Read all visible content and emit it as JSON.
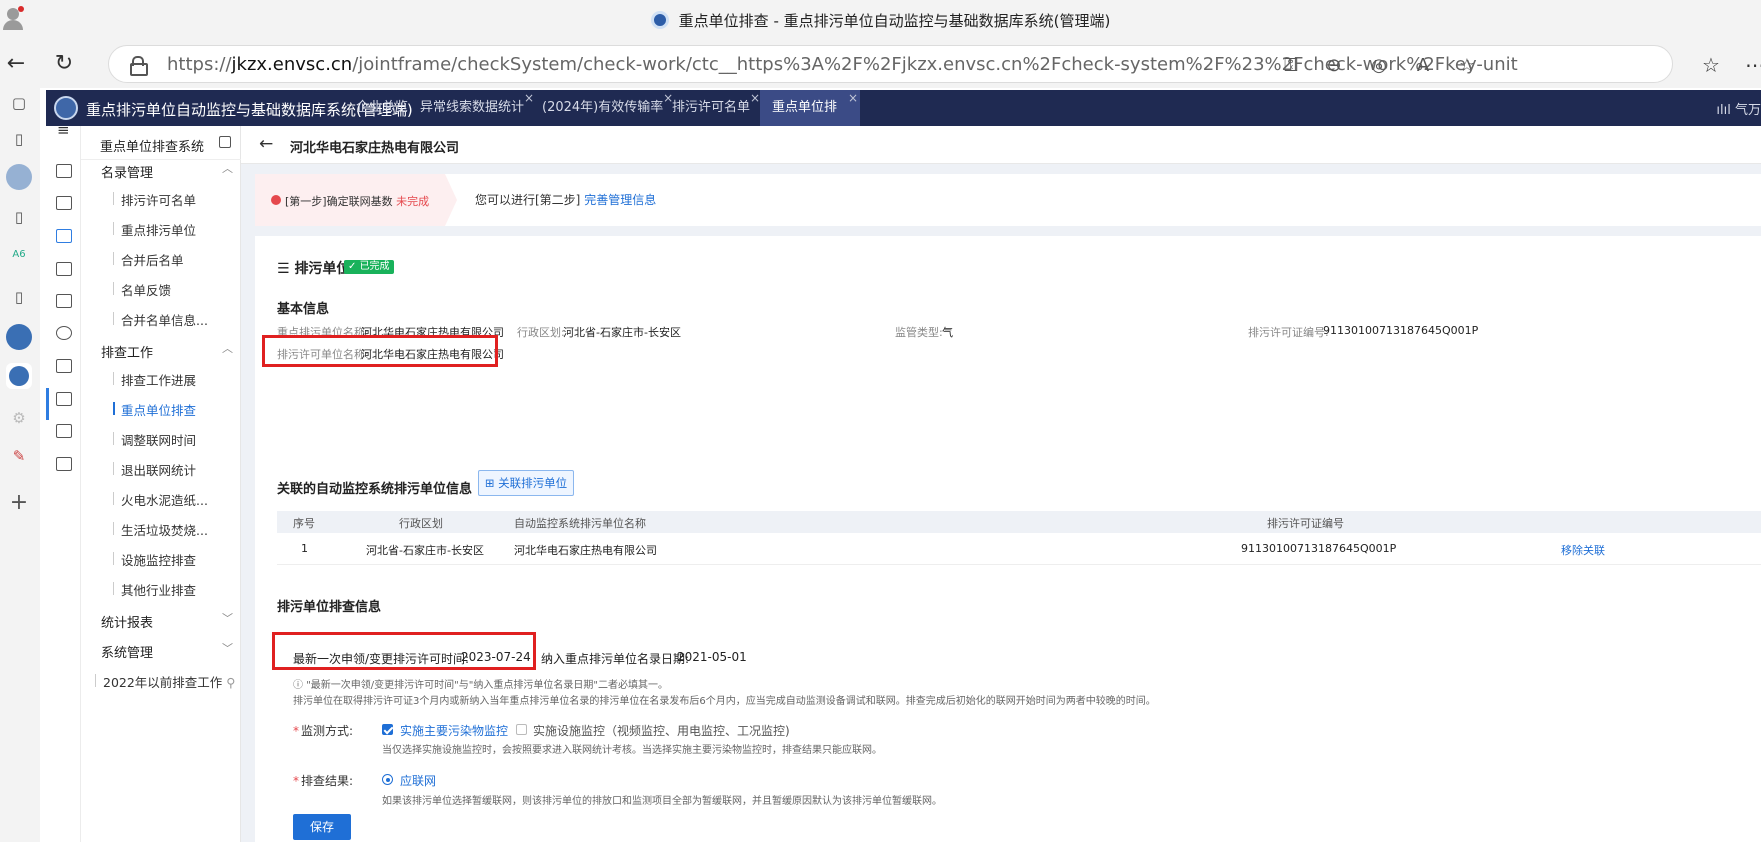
{
  "window": {
    "title": "重点单位排查 - 重点排污单位自动监控与基础数据库系统(管理端)"
  },
  "browser": {
    "url_prefix": "https://",
    "url_host": "jkzx.envsc.cn",
    "url_path": "/jointframe/checkSystem/check-work/ctc__https%3A%2F%2Fjkzx.envsc.cn%2Fcheck-system%2F%23%2Fcheck-work%2Fkey-unit"
  },
  "app": {
    "title": "重点排污单位自动监控与基础数据库系统(管理端)",
    "tabs": [
      {
        "label": "企业总览"
      },
      {
        "label": "异常线索数据统计"
      },
      {
        "label": "(2024年)有效传输率"
      },
      {
        "label": "排污许可名单"
      },
      {
        "label": "重点单位排查"
      }
    ],
    "nav_right": "气万"
  },
  "menu": {
    "title": "重点单位排查系统",
    "groups": [
      {
        "label": "名录管理",
        "items": [
          "排污许可名单",
          "重点排污单位",
          "合并后名单",
          "名单反馈",
          "合并名单信息..."
        ]
      },
      {
        "label": "排查工作",
        "items": [
          "排查工作进展",
          "重点单位排查",
          "调整联网时间",
          "退出联网统计",
          "火电水泥造纸...",
          "生活垃圾焚烧...",
          "设施监控排查",
          "其他行业排查"
        ]
      },
      {
        "label": "统计报表",
        "items": []
      },
      {
        "label": "系统管理",
        "items": []
      }
    ],
    "legacy": "2022年以前排查工作"
  },
  "page": {
    "company": "河北华电石家庄热电有限公司",
    "step1_prefix": "[第一步]确定联网基数",
    "step1_status": "未完成",
    "step2_prefix": "您可以进行[第二步]",
    "step2_link": "完善管理信息"
  },
  "unit": {
    "title": "排污单位",
    "status": "已完成",
    "basic_title": "基本信息",
    "fields": {
      "name_label": "重点排污单位名称:",
      "name_value": "河北华电石家庄热电有限公司",
      "region_label": "行政区划:",
      "region_value": "河北省-石家庄市-长安区",
      "monitor_label": "监管类型:",
      "monitor_value": "气",
      "permit_no_label": "排污许可证编号:",
      "permit_no_value": "91130100713187645Q001P",
      "permit_name_label": "排污许可单位名称:",
      "permit_name_value": "河北华电石家庄热电有限公司"
    },
    "linked_title": "关联的自动监控系统排污单位信息",
    "link_button": "关联排污单位",
    "table": {
      "headers": [
        "序号",
        "行政区划",
        "自动监控系统排污单位名称",
        "排污许可证编号"
      ],
      "rows": [
        [
          "1",
          "河北省-石家庄市-长安区",
          "河北华电石家庄热电有限公司",
          "91130100713187645Q001P"
        ]
      ],
      "action": "移除关联"
    }
  },
  "check": {
    "title": "排污单位排查信息",
    "latest_label": "最新一次申领/变更排污许可时间:",
    "latest_value": "2023-07-24",
    "join_label": "纳入重点排污单位名录日期:",
    "join_value": "2021-05-01",
    "note1": "\"最新一次申领/变更排污许可时间\"与\"纳入重点排污单位名录日期\"二者必填其一。",
    "note2": "排污单位在取得排污许可证3个月内或新纳入当年重点排污单位名录的排污单位在名录发布后6个月内，应当完成自动监测设备调试和联网。排查完成后初始化的联网开始时间为两者中较晚的时间。",
    "method_label": "监测方式:",
    "method_opt1": "实施主要污染物监控",
    "method_opt2": "实施设施监控（视频监控、用电监控、工况监控)",
    "method_note": "当仅选择实施设施监控时，会按照要求进入联网统计考核。当选择实施主要污染物监控时，排查结果只能应联网。",
    "result_label": "排查结果:",
    "result_opt": "应联网",
    "result_note": "如果该排污单位选择暂缓联网，则该排污单位的排放口和监测项目全部为暂缓联网，并且暂缓原因默认为该排污单位暂缓联网。",
    "save": "保存"
  }
}
